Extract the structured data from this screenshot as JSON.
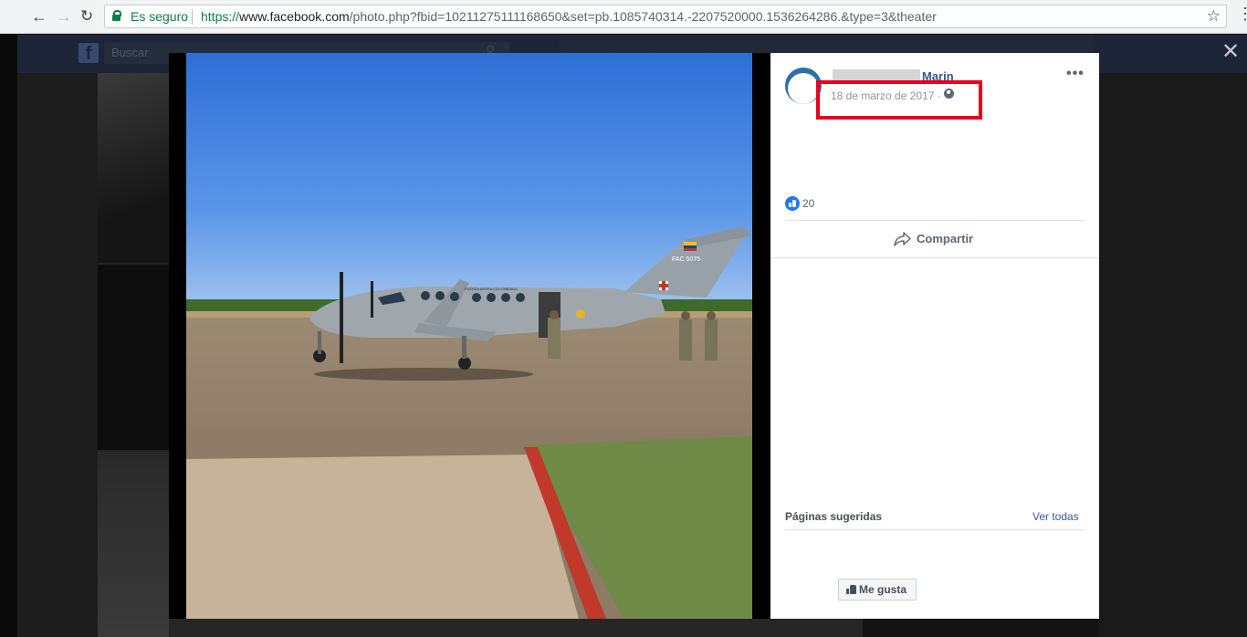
{
  "browser": {
    "secure_label": "Es seguro",
    "url_scheme": "https://",
    "url_host": "www.facebook.com",
    "url_rest": "/photo.php?fbid=10211275111168650&set=pb.1085740314.-2207520000.1536264286.&type=3&theater"
  },
  "facebook": {
    "logo": "f",
    "search_placeholder": "Buscar"
  },
  "post": {
    "author_name": "Marin",
    "date": "18 de marzo de 2017 ·",
    "like_count": "20",
    "share_label": "Compartir"
  },
  "suggested_pages": {
    "title": "Páginas sugeridas",
    "see_all": "Ver todas",
    "like_button": "Me gusta"
  },
  "photo": {
    "aircraft_text": "FAC 5075",
    "aircraft_side_text": "FUERZA AEREA COLOMBIANA"
  },
  "colors": {
    "highlight": "#e8001d",
    "fb_blue": "#385898",
    "like_blue": "#2078f4"
  }
}
